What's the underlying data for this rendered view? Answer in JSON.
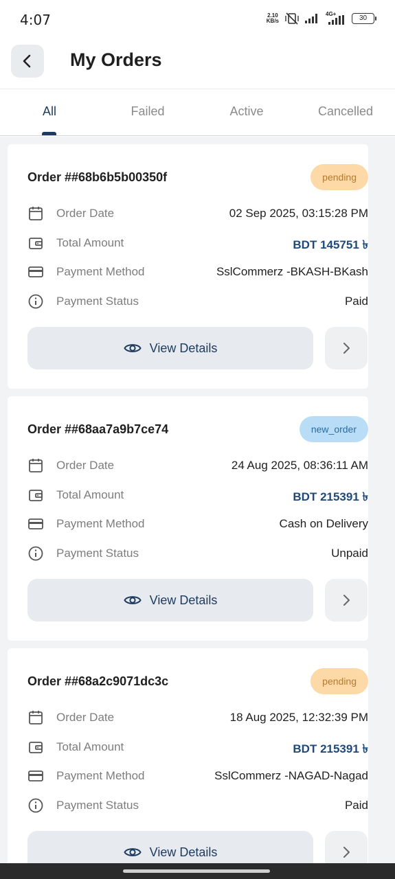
{
  "status_bar": {
    "time": "4:07",
    "speed_value": "2.10",
    "speed_unit": "KB/s",
    "network": "4G+",
    "battery": "30"
  },
  "header": {
    "title": "My Orders",
    "back_icon": "chevron-left-icon"
  },
  "tabs": [
    {
      "label": "All",
      "active": true
    },
    {
      "label": "Failed",
      "active": false
    },
    {
      "label": "Active",
      "active": false
    },
    {
      "label": "Cancelled",
      "active": false
    }
  ],
  "labels": {
    "order_date": "Order Date",
    "total_amount": "Total Amount",
    "payment_method": "Payment Method",
    "payment_status": "Payment Status",
    "view_details": "View Details"
  },
  "orders": [
    {
      "id": "Order ##68b6b5b00350f",
      "status": "pending",
      "date": "02 Sep 2025, 03:15:28 PM",
      "amount": "BDT 145751 ৳",
      "method": "SslCommerz -BKASH-BKash",
      "payment_status": "Paid"
    },
    {
      "id": "Order ##68aa7a9b7ce74",
      "status": "new_order",
      "date": "24 Aug 2025, 08:36:11 AM",
      "amount": "BDT 215391 ৳",
      "method": "Cash on Delivery",
      "payment_status": "Unpaid"
    },
    {
      "id": "Order ##68a2c9071dc3c",
      "status": "pending",
      "date": "18 Aug 2025, 12:32:39 PM",
      "amount": "BDT 215391 ৳",
      "method": "SslCommerz -NAGAD-Nagad",
      "payment_status": "Paid"
    }
  ],
  "colors": {
    "primary": "#1d3a5f",
    "pending_bg": "#fdd9a8",
    "pending_text": "#b57a2e",
    "new_order_bg": "#b9dcf7",
    "new_order_text": "#2a6d9e",
    "list_background": "#f2f3f5"
  }
}
